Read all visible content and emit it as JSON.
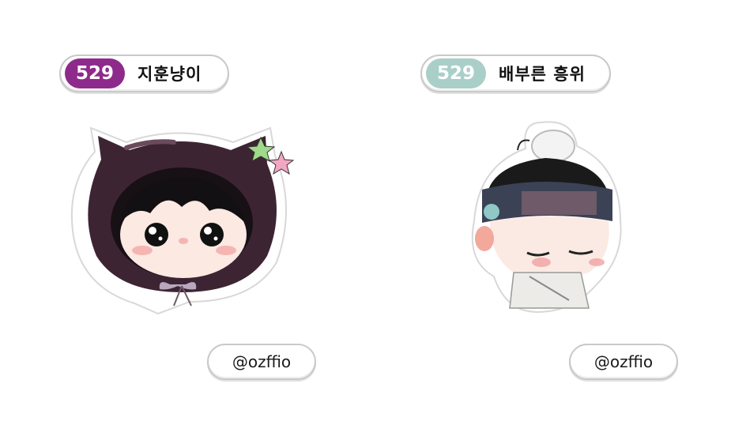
{
  "cards": [
    {
      "number": "529",
      "number_color": "#8e2a8c",
      "name": "지훈냥이",
      "handle": "@ozffio",
      "illustration": "chibi-cat-hood-character"
    },
    {
      "number": "529",
      "number_color": "#a9cfc8",
      "name": "배부른 흥위",
      "handle": "@ozffio",
      "illustration": "chibi-joseon-topknot-character"
    }
  ]
}
